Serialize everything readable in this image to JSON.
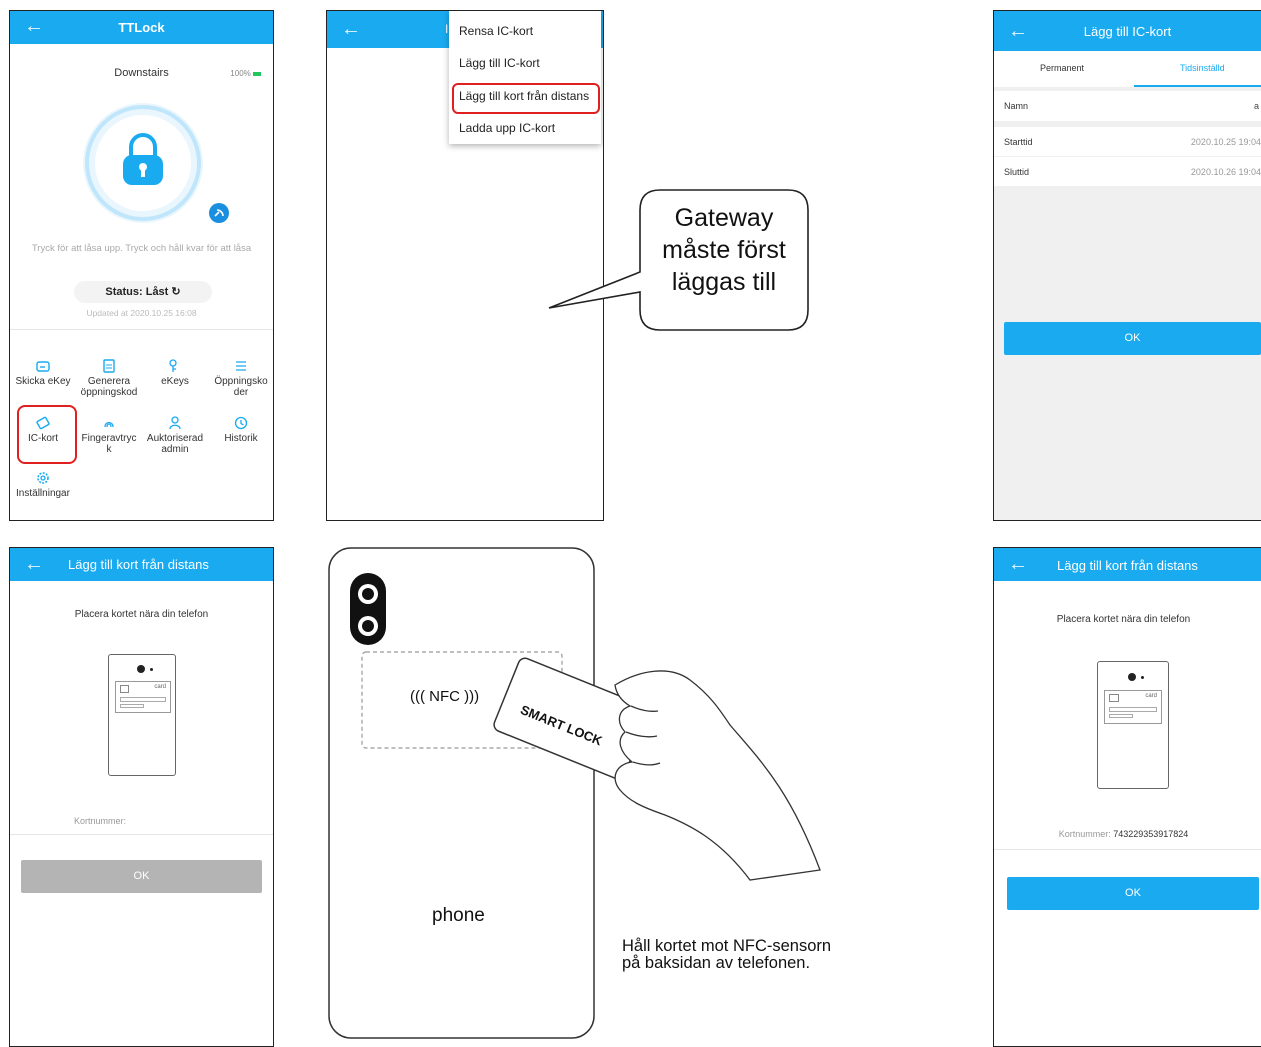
{
  "screen1": {
    "title": "TTLock",
    "lock_name": "Downstairs",
    "battery": "100%",
    "hint": "Tryck för att låsa upp. Tryck och håll kvar för att låsa",
    "status_label": "Status:",
    "status_value": "Låst",
    "updated": "Updated at 2020.10.25 16:08",
    "menu": [
      {
        "label": "Skicka eKey",
        "icon": "send-ekey-icon"
      },
      {
        "label": "Generera öppningskod",
        "icon": "keypad-icon"
      },
      {
        "label": "eKeys",
        "icon": "keys-icon"
      },
      {
        "label": "Öppningskoder",
        "icon": "passcode-list-icon"
      },
      {
        "label": "IC-kort",
        "icon": "ic-card-icon"
      },
      {
        "label": "Fingeravtryck",
        "icon": "fingerprint-icon"
      },
      {
        "label": "Auktoriserad admin",
        "icon": "admin-icon"
      },
      {
        "label": "Historik",
        "icon": "history-icon"
      },
      {
        "label": "Inställningar",
        "icon": "settings-icon"
      }
    ],
    "menu_display": [
      "Skicka eKey",
      "Generera\nöppningskod",
      "eKeys",
      "Öppningsko\nder",
      "IC-kort",
      "Fingeravtryc\nk",
      "Auktoriserad\nadmin",
      "Historik",
      "Inställningar"
    ]
  },
  "screen2": {
    "title_fragment": "I",
    "menu": [
      "Rensa IC-kort",
      "Lägg till IC-kort",
      "Lägg till kort från distans",
      "Ladda upp IC-kort"
    ],
    "callout": [
      "Gateway",
      "måste först",
      "läggas till"
    ]
  },
  "screen3": {
    "title": "Lägg till IC-kort",
    "tabs": [
      "Permanent",
      "Tidsinställd"
    ],
    "active_tab": "Tidsinställd",
    "name_label": "Namn",
    "name_value": "a",
    "start_label": "Starttid",
    "start_value": "2020.10.25 19:04",
    "end_label": "Sluttid",
    "end_value": "2020.10.26 19:04",
    "ok": "OK"
  },
  "screen4": {
    "title": "Lägg till kort från distans",
    "instruction": "Placera kortet nära din telefon",
    "card_label": "card",
    "card_number_label": "Kortnummer:",
    "ok": "OK"
  },
  "illustration": {
    "nfc_label": "NFC",
    "card_text": "SMART LOCK",
    "phone_label": "phone",
    "caption_line1": "Håll kortet mot NFC-sensorn",
    "caption_line2": "på baksidan av telefonen."
  },
  "screen5": {
    "title": "Lägg till kort från distans",
    "instruction": "Placera kortet nära din telefon",
    "card_label": "card",
    "card_number_label": "Kortnummer:",
    "card_number": "743229353917824",
    "ok": "OK"
  },
  "colors": {
    "accent": "#1aaaf0",
    "highlight": "#e02020",
    "disabled": "#b4b4b4",
    "battery": "#22c55e"
  }
}
